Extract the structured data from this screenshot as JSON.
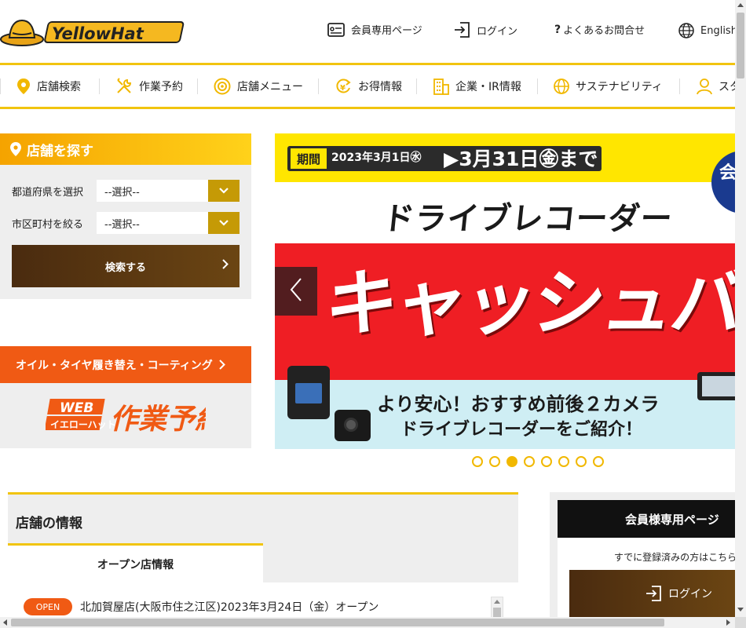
{
  "header": {
    "logo_text": "YellowHat",
    "links": {
      "member_page": "会員専用ページ",
      "login": "ログイン",
      "faq": "よくあるお問合せ",
      "language": "English"
    }
  },
  "nav": {
    "items": [
      {
        "label": "店舗検索",
        "icon": "map-pin-icon"
      },
      {
        "label": "作業予約",
        "icon": "tools-icon"
      },
      {
        "label": "店舗メニュー",
        "icon": "tire-icon"
      },
      {
        "label": "お得情報",
        "icon": "coin-icon"
      },
      {
        "label": "企業・IR情報",
        "icon": "building-icon"
      },
      {
        "label": "サステナビリティ",
        "icon": "globe-icon"
      },
      {
        "label": "スタ",
        "icon": "person-icon"
      }
    ]
  },
  "shop_search": {
    "title": "店舗を探す",
    "prefecture_label": "都道府県を選択",
    "prefecture_value": "--選択--",
    "city_label": "市区町村を絞る",
    "city_value": "--選択--",
    "search_button": "検索する"
  },
  "promo": {
    "banner_label": "オイル・タイヤ履き替え・コーティング",
    "web_top": "WEB",
    "web_sub": "イエローハット",
    "web_main": "作業予約"
  },
  "carousel": {
    "period_tag": "期間",
    "period_start": "2023年3月1日㊌",
    "period_end": "▶3月31日㊎まで",
    "subtitle": "ドライブレコーダー",
    "headline": "キャッシュバック",
    "bottom_line1": "より安心！おすすめ前後２カメラ",
    "bottom_line2": "ドライブレコーダーをご紹介！",
    "badge": "会",
    "dot_count": 8,
    "active_dot": 2
  },
  "shop_info": {
    "title": "店舗の情報",
    "tab_label": "オープン店情報",
    "rows": [
      {
        "badge": "OPEN",
        "text": "北加賀屋店(大阪市住之江区)2023年3月24日（金）オープン"
      }
    ]
  },
  "member": {
    "title": "会員様専用ページ",
    "note": "すでに登録済みの方はこちら",
    "login_button": "ログイン"
  },
  "colors": {
    "accent_yellow": "#f1c40f",
    "brand_brown": "#4a2b0f",
    "promo_orange": "#f05a14",
    "banner_red": "#ef1e24"
  }
}
